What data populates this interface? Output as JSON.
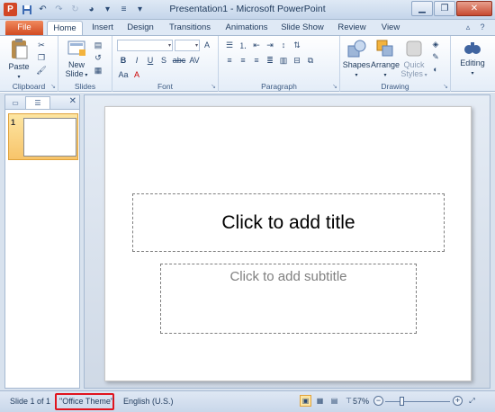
{
  "window": {
    "title": "Presentation1 - Microsoft PowerPoint"
  },
  "qat": {
    "app_icon": "P"
  },
  "tabs": [
    "File",
    "Home",
    "Insert",
    "Design",
    "Transitions",
    "Animations",
    "Slide Show",
    "Review",
    "View"
  ],
  "ribbon": {
    "clipboard": {
      "label": "Clipboard",
      "paste": "Paste"
    },
    "slides": {
      "label": "Slides",
      "new_slide_1": "New",
      "new_slide_2": "Slide"
    },
    "font": {
      "label": "Font",
      "bold": "B",
      "italic": "I",
      "underline": "U",
      "strike": "S",
      "shadow": "abc"
    },
    "paragraph": {
      "label": "Paragraph"
    },
    "drawing": {
      "label": "Drawing",
      "shapes": "Shapes",
      "arrange": "Arrange",
      "quick_styles_1": "Quick",
      "quick_styles_2": "Styles"
    },
    "editing": {
      "label": "Editing"
    }
  },
  "slides_panel": {
    "thumb_number": "1"
  },
  "slide": {
    "title_placeholder": "Click to add title",
    "subtitle_placeholder": "Click to add subtitle"
  },
  "status": {
    "slide_info": "Slide 1 of 1",
    "theme": "\"Office Theme\"",
    "language": "English (U.S.)",
    "zoom": "57%",
    "zoom_fraction": 0.57
  },
  "colors": {
    "file_tab": "#d14b22",
    "highlight": "#e0141e",
    "selected_view": "#fde6a3"
  }
}
